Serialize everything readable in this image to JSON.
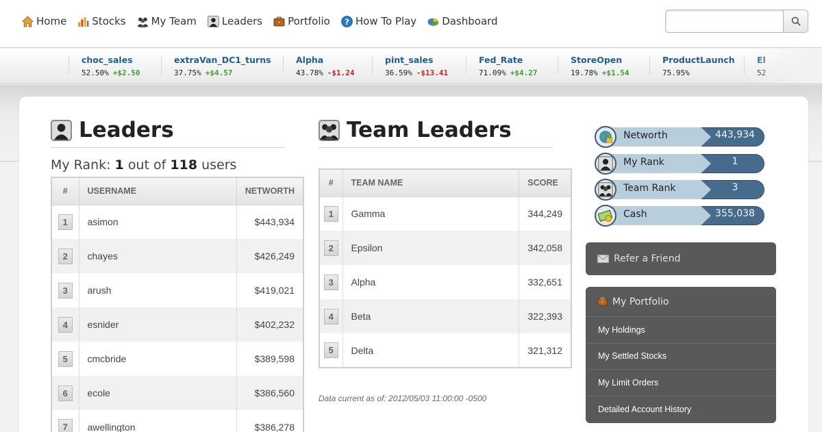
{
  "nav": {
    "items": [
      {
        "label": "Home",
        "icon": "home-icon"
      },
      {
        "label": "Stocks",
        "icon": "stocks-icon"
      },
      {
        "label": "My Team",
        "icon": "team-icon"
      },
      {
        "label": "Leaders",
        "icon": "user-icon"
      },
      {
        "label": "Portfolio",
        "icon": "briefcase-icon"
      },
      {
        "label": "How To Play",
        "icon": "help-icon"
      },
      {
        "label": "Dashboard",
        "icon": "pie-chart-icon"
      }
    ],
    "search_placeholder": ""
  },
  "ticker": [
    {
      "name": "choc_sales",
      "pct": "52.50%",
      "change": "+$2.50",
      "dir": "up"
    },
    {
      "name": "extraVan_DC1_turns",
      "pct": "37.75%",
      "change": "+$4.57",
      "dir": "up"
    },
    {
      "name": "Alpha",
      "pct": "43.78%",
      "change": "-$1.24",
      "dir": "down"
    },
    {
      "name": "pint_sales",
      "pct": "36.59%",
      "change": "-$13.41",
      "dir": "down"
    },
    {
      "name": "Fed_Rate",
      "pct": "71.09%",
      "change": "+$4.27",
      "dir": "up"
    },
    {
      "name": "StoreOpen",
      "pct": "19.78%",
      "change": "+$1.54",
      "dir": "up"
    },
    {
      "name": "ProductLaunch",
      "pct": "75.95%",
      "change": "",
      "dir": "up"
    },
    {
      "name": "El",
      "pct": "52",
      "change": "",
      "dir": "up"
    }
  ],
  "leaders": {
    "title": "Leaders",
    "rank_prefix": "My Rank: ",
    "rank": "1",
    "rank_mid": " out of ",
    "total": "118",
    "rank_suffix": " users",
    "columns": [
      "#",
      "USERNAME",
      "NETWORTH"
    ],
    "rows": [
      {
        "rank": "1",
        "user": "asimon",
        "networth": "$443,934"
      },
      {
        "rank": "2",
        "user": "chayes",
        "networth": "$426,249"
      },
      {
        "rank": "3",
        "user": "arush",
        "networth": "$419,021"
      },
      {
        "rank": "4",
        "user": "esnider",
        "networth": "$402,232"
      },
      {
        "rank": "5",
        "user": "cmcbride",
        "networth": "$389,598"
      },
      {
        "rank": "6",
        "user": "ecole",
        "networth": "$386,560"
      },
      {
        "rank": "7",
        "user": "awellington",
        "networth": "$386,278"
      }
    ]
  },
  "team_leaders": {
    "title": "Team Leaders",
    "columns": [
      "#",
      "TEAM NAME",
      "SCORE"
    ],
    "rows": [
      {
        "rank": "1",
        "team": "Gamma",
        "score": "344,249"
      },
      {
        "rank": "2",
        "team": "Epsilon",
        "score": "342,058"
      },
      {
        "rank": "3",
        "team": "Alpha",
        "score": "332,651"
      },
      {
        "rank": "4",
        "team": "Beta",
        "score": "322,393"
      },
      {
        "rank": "5",
        "team": "Delta",
        "score": "321,312"
      }
    ],
    "data_note": "Data current as of: 2012/05/03 11:00:00 -0500"
  },
  "stats": [
    {
      "label": "Networth",
      "value": "443,934",
      "icon": "globe-icon"
    },
    {
      "label": "My Rank",
      "value": "1",
      "icon": "user-icon"
    },
    {
      "label": "Team Rank",
      "value": "3",
      "icon": "team-icon"
    },
    {
      "label": "Cash",
      "value": "355,038",
      "icon": "cash-icon"
    }
  ],
  "sidebar": {
    "refer_label": "Refer a Friend",
    "portfolio_title": "My Portfolio",
    "portfolio_links": [
      "My Holdings",
      "My Settled Stocks",
      "My Limit Orders",
      "Detailed Account History"
    ]
  },
  "colors": {
    "up": "#3aa02f",
    "down": "#c8231f",
    "link": "#1d5f96",
    "stat_dark": "#476b8c",
    "stat_light": "#b9cedd",
    "sidebar_panel": "#595959"
  }
}
